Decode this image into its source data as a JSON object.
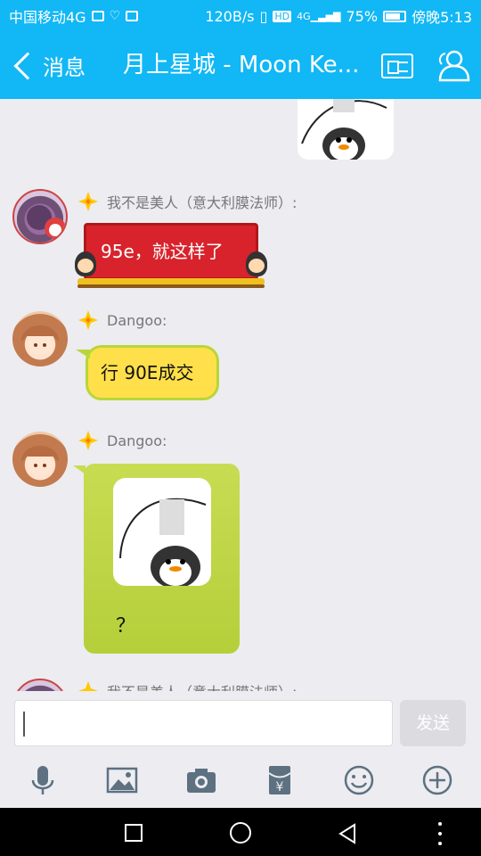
{
  "status_bar": {
    "carrier": "中国移动4G",
    "speed": "120B/s",
    "hd": "HD",
    "network": "4G",
    "battery": "75%",
    "time": "傍晚5:13"
  },
  "title_bar": {
    "back_label": "消息",
    "title": "月上星城 - Moon Ke..."
  },
  "messages": [
    {
      "sender": "我不是美人（意大利膜法师）:",
      "text": "95e，就这样了",
      "style": "red-banner"
    },
    {
      "sender": "Dangoo:",
      "text": "行 90E成交",
      "style": "yellow"
    },
    {
      "sender": "Dangoo:",
      "text": "？",
      "style": "green-with-sticker"
    },
    {
      "sender": "我不是美人（意大利膜法师）:",
      "text": "",
      "style": "partial"
    }
  ],
  "input": {
    "value": "",
    "send_label": "发送"
  },
  "toolbar": {
    "icons": [
      "microphone-icon",
      "image-icon",
      "camera-icon",
      "red-packet-icon",
      "emoji-icon",
      "plus-icon"
    ]
  },
  "colors": {
    "accent": "#12b7f5",
    "red_banner": "#d8232c",
    "yellow_bubble": "#ffe04a",
    "green_bubble": "#c8dc52",
    "background": "#ececf1"
  }
}
